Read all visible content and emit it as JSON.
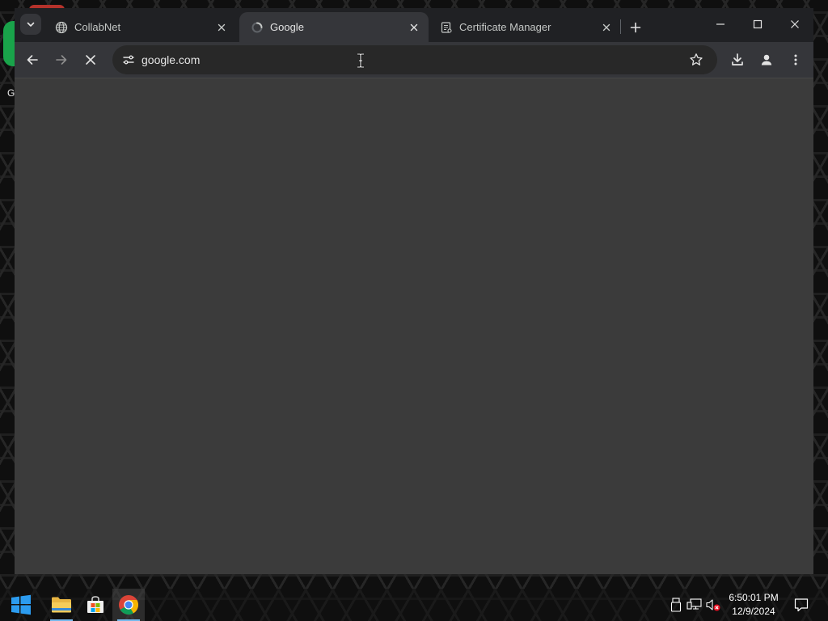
{
  "desktop": {
    "partial_label": "G"
  },
  "browser": {
    "tabs": [
      {
        "title": "CollabNet",
        "favicon": "globe-icon",
        "active": false
      },
      {
        "title": "Google",
        "favicon": "loading-spinner-icon",
        "active": true
      },
      {
        "title": "Certificate Manager",
        "favicon": "certificate-page-icon",
        "active": false
      }
    ],
    "address": {
      "url": "google.com",
      "loading": true
    }
  },
  "taskbar": {
    "apps": [
      {
        "name": "start-button",
        "icon": "windows-logo-icon"
      },
      {
        "name": "file-explorer",
        "icon": "folder-icon"
      },
      {
        "name": "microsoft-store",
        "icon": "store-bag-icon"
      },
      {
        "name": "google-chrome",
        "icon": "chrome-icon",
        "active": true
      }
    ],
    "clock": {
      "time": "6:50:01 PM",
      "date": "12/9/2024"
    }
  },
  "colors": {
    "content_bg": "#3b3b3b",
    "toolbar_bg": "#35363a",
    "tabstrip_bg": "#202124",
    "accent": "#76b9ed",
    "mute_badge": "#e81123"
  }
}
